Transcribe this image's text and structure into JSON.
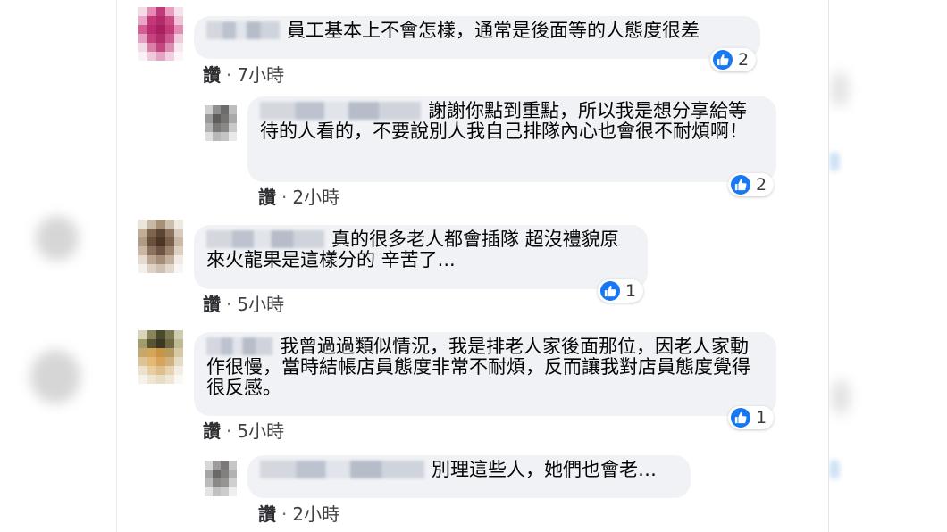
{
  "like_label": "讚",
  "separator": "·",
  "comments": [
    {
      "text": "員工基本上不會怎樣，通常是後面等的人態度很差",
      "time": "7小時",
      "reactions": "2"
    },
    {
      "text": "謝謝你點到重點，所以我是想分享給等待的人看的，不要說別人我自己排隊內心也會很不耐煩啊！",
      "time": "2小時",
      "reactions": "2"
    },
    {
      "text": "真的很多老人都會插隊 超沒禮貌原來火龍果是這樣分的 辛苦了...",
      "time": "5小時",
      "reactions": "1"
    },
    {
      "text": "我曾過過類似情況，我是排老人家後面那位，因老人家動作很慢，當時結帳店員態度非常不耐煩，反而讓我對店員態度覺得很反感。",
      "time": "5小時",
      "reactions": "1"
    },
    {
      "text": "別理這些人，她們也會老…",
      "time": "2小時",
      "reactions": ""
    }
  ],
  "icons": {
    "like": "like-thumb-icon"
  },
  "colors": {
    "accent": "#1877f2",
    "bubble": "#f0f2f5"
  }
}
